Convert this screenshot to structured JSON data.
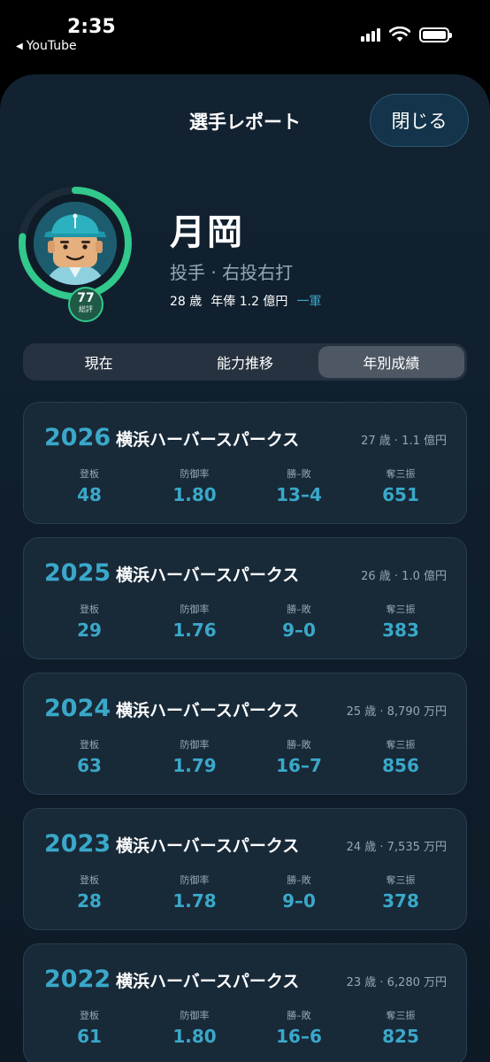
{
  "status_bar": {
    "time": "2:35",
    "back_label": "YouTube"
  },
  "header": {
    "title": "選手レポート",
    "close_label": "閉じる"
  },
  "player": {
    "name": "月岡",
    "position": "投手 · 右投右打",
    "age": "28 歳",
    "salary": "年俸 1.2 億円",
    "squad": "一軍",
    "rating": "77",
    "rating_label": "総評",
    "rating_fraction": 0.77
  },
  "tabs": [
    {
      "label": "現在",
      "active": false
    },
    {
      "label": "能力推移",
      "active": false
    },
    {
      "label": "年別成績",
      "active": true
    }
  ],
  "stat_labels": [
    "登板",
    "防御率",
    "勝–敗",
    "奪三振"
  ],
  "seasons": [
    {
      "year": "2026",
      "team": "横浜ハーバースパークス",
      "info": "27 歳 · 1.1 億円",
      "stats": [
        "48",
        "1.80",
        "13–4",
        "651"
      ]
    },
    {
      "year": "2025",
      "team": "横浜ハーバースパークス",
      "info": "26 歳 · 1.0 億円",
      "stats": [
        "29",
        "1.76",
        "9–0",
        "383"
      ]
    },
    {
      "year": "2024",
      "team": "横浜ハーバースパークス",
      "info": "25 歳 · 8,790 万円",
      "stats": [
        "63",
        "1.79",
        "16–7",
        "856"
      ]
    },
    {
      "year": "2023",
      "team": "横浜ハーバースパークス",
      "info": "24 歳 · 7,535 万円",
      "stats": [
        "28",
        "1.78",
        "9–0",
        "378"
      ]
    },
    {
      "year": "2022",
      "team": "横浜ハーバースパークス",
      "info": "23 歳 · 6,280 万円",
      "stats": [
        "61",
        "1.80",
        "16–6",
        "825"
      ]
    }
  ],
  "colors": {
    "accent": "#3aa8c9",
    "rating_ring": "#31c98c",
    "background": "#122231"
  }
}
